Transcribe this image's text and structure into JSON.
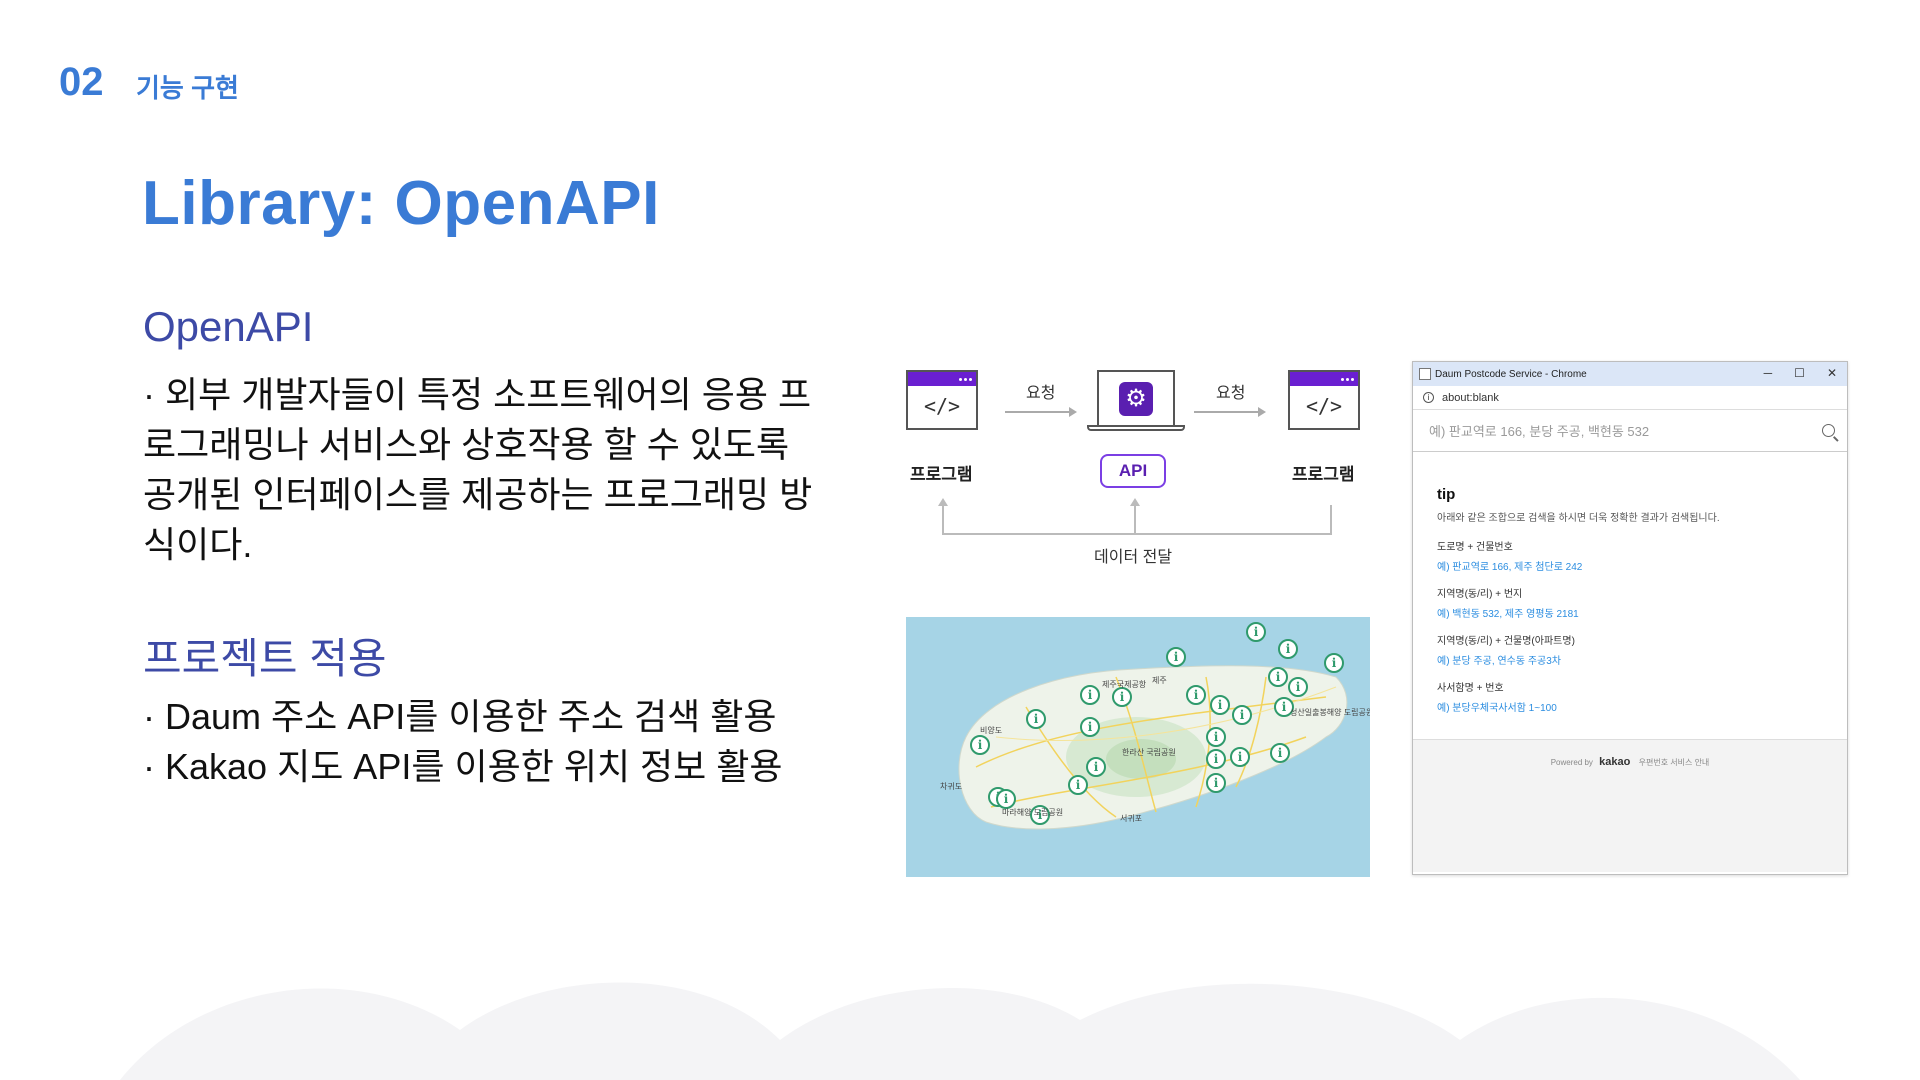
{
  "section": {
    "number": "02",
    "name": "기능 구현"
  },
  "title": "Library: OpenAPI",
  "openapi": {
    "heading": "OpenAPI",
    "lines": [
      "· 외부 개발자들이 특정 소프트웨어의 응용 프",
      "로그래밍나 서비스와 상호작용 할 수 있도록",
      "공개된 인터페이스를 제공하는 프로그래밍 방",
      "식이다."
    ]
  },
  "project": {
    "heading": "프로젝트 적용",
    "items": [
      "· Daum 주소 API를 이용한 주소 검색 활용",
      "· Kakao 지도 API를 이용한 위치 정보 활용"
    ]
  },
  "diagram": {
    "left_label": "프로그램",
    "right_label": "프로그램",
    "request_left": "요청",
    "request_right": "요청",
    "api": "API",
    "data_transfer": "데이터 전달",
    "code_glyph": "</>",
    "left_icon": "code-window-icon",
    "center_icon": "gear-icon",
    "right_icon": "code-window-icon",
    "accent": "#6a1fd1"
  },
  "map": {
    "labels": [
      "제주국제공항",
      "제주",
      "한라산 국립공원",
      "서귀포",
      "성산일출봉해양 도립공원",
      "비양도",
      "차귀도",
      "마라해양 도립공원"
    ],
    "water_color": "#a6d4e6",
    "pin_icon": "info-pin-icon"
  },
  "browser": {
    "window_title": "Daum Postcode Service - Chrome",
    "address": "about:blank",
    "search_placeholder": "예) 판교역로 166, 분당 주공, 백현동 532",
    "tip_title": "tip",
    "tip_desc": "아래와 같은 조합으로 검색을 하시면 더욱 정확한 결과가 검색됩니다.",
    "tips": [
      {
        "title": "도로명 + 건물번호",
        "example": "예) 판교역로 166,  제주 첨단로 242"
      },
      {
        "title": "지역명(동/리) + 번지",
        "example": "예) 백현동 532,  제주 영평동 2181"
      },
      {
        "title": "지역명(동/리) + 건물명(아파트명)",
        "example": "예) 분당 주공,  연수동 주공3차"
      },
      {
        "title": "사서함명 + 번호",
        "example": "예) 분당우체국사서함 1~100"
      }
    ],
    "footer_powered": "Powered by",
    "footer_brand": "kakao",
    "footer_link": "우편번호 서비스 안내"
  }
}
